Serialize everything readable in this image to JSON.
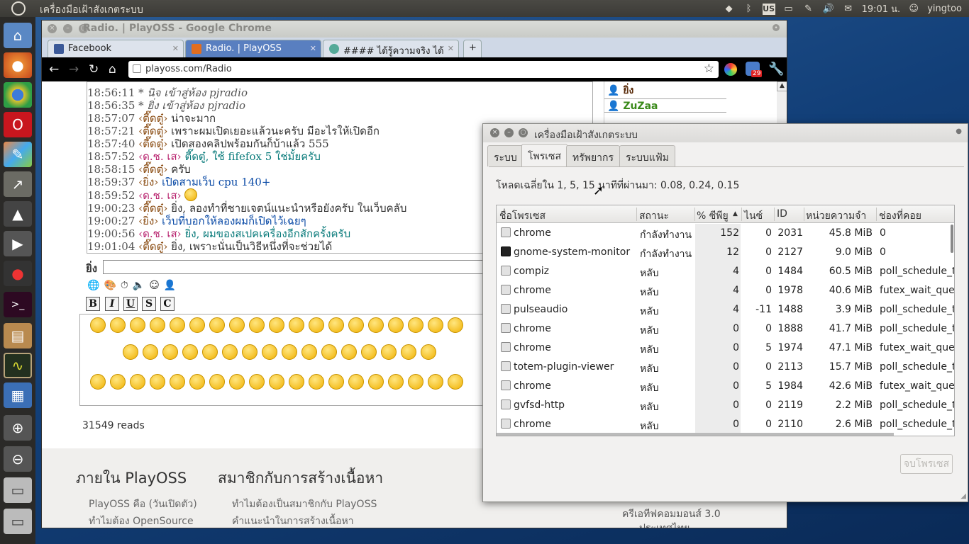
{
  "top_panel": {
    "app_title": "เครื่องมือเฝ้าสังเกตระบบ",
    "keyboard_layout": "US",
    "clock": "19:01 น.",
    "user": "yingtoo"
  },
  "launcher": {
    "items": [
      "home-folder",
      "firefox",
      "chrome",
      "opera",
      "paint",
      "charts",
      "vlc",
      "video",
      "record",
      "terminal",
      "archive",
      "system-monitor",
      "workspaces",
      "zoom-in",
      "zoom-out",
      "drive-1",
      "drive-2"
    ]
  },
  "chrome": {
    "title": "Radio. | PlayOSS - Google Chrome",
    "tabs": [
      {
        "label": "Facebook"
      },
      {
        "label": "Radio. | PlayOSS"
      },
      {
        "label": "#### ได้รู้ความจริง ได้ยิ..."
      }
    ],
    "url": "playoss.com/Radio",
    "ext_badge": "29"
  },
  "chat": {
    "lines": [
      {
        "time": "18:56:11",
        "nick": "",
        "text": "* นิจ เข้าสู่ห้อง pjradio",
        "style": "act"
      },
      {
        "time": "18:56:35",
        "nick": "",
        "text": "* ยิ่ง เข้าสู่ห้อง pjradio",
        "style": "act"
      },
      {
        "time": "18:57:07",
        "nick": "‹ตี๊ดตู๋›",
        "text": "น่าจะมาก",
        "style": "plain"
      },
      {
        "time": "18:57:21",
        "nick": "‹ตี๊ดตู๋›",
        "text": "เพราะผมเปิดเยอะแล้วนะครับ มีอะไรให้เปิดอีก",
        "style": "plain"
      },
      {
        "time": "18:57:40",
        "nick": "‹ตี๊ดตู๋›",
        "text": "เปิดสองคลิปพร้อมกันก็บ้าแล้ว 555",
        "style": "plain"
      },
      {
        "time": "18:57:52",
        "nick": "‹ด.ช. เส›",
        "text": "ตี๊ดตู๋, ใช้ fifefox 5 ใช่มั้ยครับ",
        "style": "teal"
      },
      {
        "time": "18:58:15",
        "nick": "‹ตี๊ดตู๋›",
        "text": "ครับ",
        "style": "plain"
      },
      {
        "time": "18:59:37",
        "nick": "‹ยิ่ง›",
        "text": "เปิดสามเว็บ  cpu 140+",
        "style": "blue"
      },
      {
        "time": "18:59:52",
        "nick": "‹ด.ช. เส›",
        "text": "",
        "style": "emoji"
      },
      {
        "time": "19:00:23",
        "nick": "‹ตี๊ดตู๋›",
        "text": "ยิ่ง, ลองทำที่ชายเจตน์แนะนำหรือยังครับ ในเว็บคลับ",
        "style": "plain"
      },
      {
        "time": "19:00:27",
        "nick": "‹ยิ่ง›",
        "text": "เว็บที่บอกให้ลองผมก็เปิดไว้เฉยๆ",
        "style": "blue"
      },
      {
        "time": "19:00:56",
        "nick": "‹ด.ช. เส›",
        "text": "ยิ่ง, ผมของสเปคเครื่องอีกสักครั้งครับ",
        "style": "teal"
      },
      {
        "time": "19:01:04",
        "nick": "‹ตี๊ดตู๋›",
        "text": "ยิ่ง, เพราะนั่นเป็นวิธีหนึ่งที่จะช่วยได้",
        "style": "plain"
      }
    ],
    "input_label": "ยิ่ง",
    "format_buttons": [
      "B",
      "I",
      "U",
      "S",
      "C"
    ],
    "users": [
      "ยิ่ง",
      "ZuZaa"
    ],
    "reads": "31549 reads"
  },
  "footer": {
    "col1_title": "ภายใน PlayOSS",
    "col1_links": [
      "PlayOSS คือ (วันเปิดตัว)",
      "ทำไมต้อง OpenSource"
    ],
    "col2_title": "สมาชิกกับการสร้างเนื้อหา",
    "col2_links": [
      "ทำไมต้องเป็นสมาชิกกับ PlayOSS",
      "คำแนะนำในการสร้างเนื้อหา"
    ],
    "license": "ครีเอทีฟคอมมอนส์ 3.0",
    "license2": "ประเทศไทย"
  },
  "sysmon": {
    "title": "เครื่องมือเฝ้าสังเกตระบบ",
    "tabs": [
      "ระบบ",
      "โพรเซส",
      "ทรัพยากร",
      "ระบบแฟ้ม"
    ],
    "active_tab": "โพรเซส",
    "load_text": "โหลดเฉลี่ยใน 1, 5, 15 นาทีที่ผ่านมา: 0.08, 0.24, 0.15",
    "columns": [
      "ชื่อโพรเซส",
      "สถานะ",
      "% ซีพียู",
      "ไนซ์",
      "ID",
      "หน่วยความจำ",
      "ช่องที่คอย"
    ],
    "sort_indicator": "▲",
    "processes": [
      {
        "name": "chrome",
        "status": "กำลังทำงาน",
        "cpu": "152",
        "nice": "0",
        "id": "2031",
        "mem": "45.8 MiB",
        "wait": "0"
      },
      {
        "name": "gnome-system-monitor",
        "status": "กำลังทำงาน",
        "cpu": "12",
        "nice": "0",
        "id": "2127",
        "mem": "9.0 MiB",
        "wait": "0"
      },
      {
        "name": "compiz",
        "status": "หลับ",
        "cpu": "4",
        "nice": "0",
        "id": "1484",
        "mem": "60.5 MiB",
        "wait": "poll_schedule_t"
      },
      {
        "name": "chrome",
        "status": "หลับ",
        "cpu": "4",
        "nice": "0",
        "id": "1978",
        "mem": "40.6 MiB",
        "wait": "futex_wait_que"
      },
      {
        "name": "pulseaudio",
        "status": "หลับ",
        "cpu": "4",
        "nice": "-11",
        "id": "1488",
        "mem": "3.9 MiB",
        "wait": "poll_schedule_t"
      },
      {
        "name": "chrome",
        "status": "หลับ",
        "cpu": "0",
        "nice": "0",
        "id": "1888",
        "mem": "41.7 MiB",
        "wait": "poll_schedule_t"
      },
      {
        "name": "chrome",
        "status": "หลับ",
        "cpu": "0",
        "nice": "5",
        "id": "1974",
        "mem": "47.1 MiB",
        "wait": "futex_wait_que"
      },
      {
        "name": "totem-plugin-viewer",
        "status": "หลับ",
        "cpu": "0",
        "nice": "0",
        "id": "2113",
        "mem": "15.7 MiB",
        "wait": "poll_schedule_t"
      },
      {
        "name": "chrome",
        "status": "หลับ",
        "cpu": "0",
        "nice": "5",
        "id": "1984",
        "mem": "42.6 MiB",
        "wait": "futex_wait_que"
      },
      {
        "name": "gvfsd-http",
        "status": "หลับ",
        "cpu": "0",
        "nice": "0",
        "id": "2119",
        "mem": "2.2 MiB",
        "wait": "poll_schedule_t"
      },
      {
        "name": "chrome",
        "status": "หลับ",
        "cpu": "0",
        "nice": "0",
        "id": "2110",
        "mem": "2.6 MiB",
        "wait": "poll_schedule_t"
      }
    ],
    "end_button": "จบโพรเซส"
  }
}
